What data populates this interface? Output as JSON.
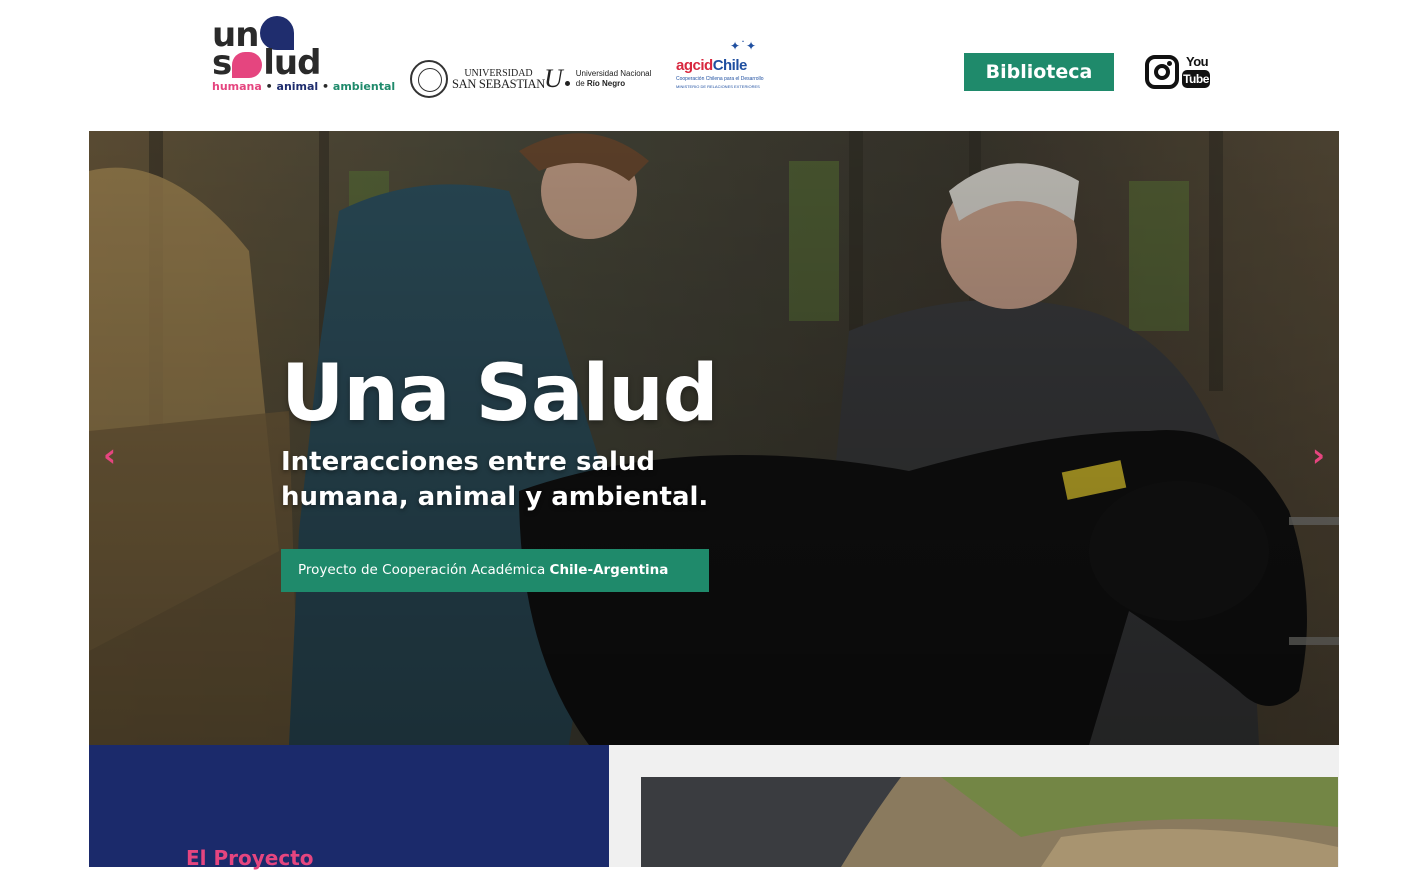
{
  "header": {
    "logo": {
      "word_top_left": "un",
      "word_top_right": "lud",
      "word_bottom_left": "s",
      "tag_humana": "humana",
      "tag_animal": "animal",
      "tag_ambiental": "ambiental",
      "tag_separator": " • "
    },
    "partners": {
      "uss_line1": "UNIVERSIDAD",
      "uss_line2": "SAN SEBASTIAN",
      "unrn_letter": "U",
      "unrn_line1": "Universidad Nacional",
      "unrn_line2_prefix": "de ",
      "unrn_line2_bold": "Río Negro",
      "agcid_red": "agcid",
      "agcid_blue": "Chile",
      "agcid_sub": "Cooperación Chilena para el Desarrollo",
      "agcid_sub2": "MINISTERIO DE RELACIONES EXTERIORES"
    },
    "biblioteca_label": "Biblioteca",
    "youtube_you": "You",
    "youtube_tube": "Tube"
  },
  "hero": {
    "title": "Una Salud",
    "subtitle_line1": "Interacciones entre salud",
    "subtitle_line2": "humana, animal y ambiental.",
    "badge_text": "Proyecto de Cooperación Académica ",
    "badge_bold": "Chile-Argentina",
    "arrow_left": "‹",
    "arrow_right": "›"
  },
  "section": {
    "title": "El Proyecto"
  },
  "colors": {
    "brand_green": "#1f8a6b",
    "brand_pink": "#e5457f",
    "brand_navy": "#1b2a6b",
    "panel_gray": "#f0f0f0"
  },
  "icons": [
    "instagram-icon",
    "youtube-icon",
    "chevron-left-icon",
    "chevron-right-icon"
  ]
}
